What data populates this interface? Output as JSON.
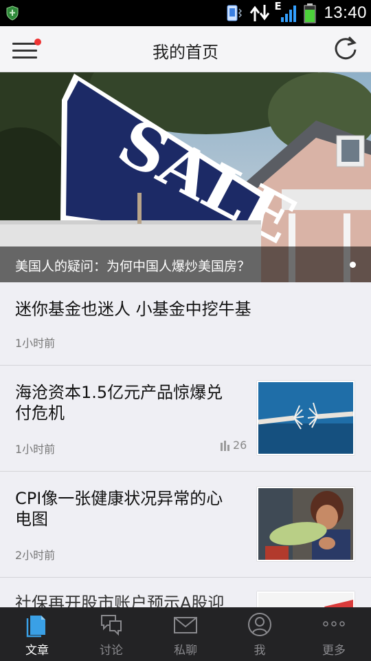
{
  "status_bar": {
    "time": "13:40",
    "network": "E"
  },
  "header": {
    "title": "我的首页"
  },
  "banner": {
    "caption": "美国人的疑问：为何中国人爆炒美国房？",
    "sign_text": "SALE"
  },
  "articles": [
    {
      "title": "迷你基金也迷人 小基金中挖牛基",
      "time": "1小时前"
    },
    {
      "title_line1": "海沧资本1.5亿元产品惊爆兑",
      "title_line2": "付危机",
      "time": "1小时前",
      "count": "26"
    },
    {
      "title_line1": "CPI像一张健康状况异常的心",
      "title_line2": "电图",
      "time": "2小时前"
    },
    {
      "title": "社保再开股市账户预示A股迎"
    }
  ],
  "bottom_nav": {
    "tabs": [
      {
        "label": "文章",
        "icon": "document-icon",
        "active": true
      },
      {
        "label": "讨论",
        "icon": "chat-bubbles-icon",
        "active": false
      },
      {
        "label": "私聊",
        "icon": "envelope-icon",
        "active": false
      },
      {
        "label": "我",
        "icon": "person-icon",
        "active": false
      },
      {
        "label": "更多",
        "icon": "more-dots-icon",
        "active": false
      }
    ]
  },
  "colors": {
    "status_bar_bg": "#000000",
    "header_bg": "#f5f5f7",
    "page_bg": "#efeff4",
    "bottom_nav_bg": "#232325",
    "active_tab_icon": "#3aa0e6",
    "notification_dot": "#e33333",
    "battery_green": "#4cd13a",
    "signal_blue": "#33a0ff"
  }
}
